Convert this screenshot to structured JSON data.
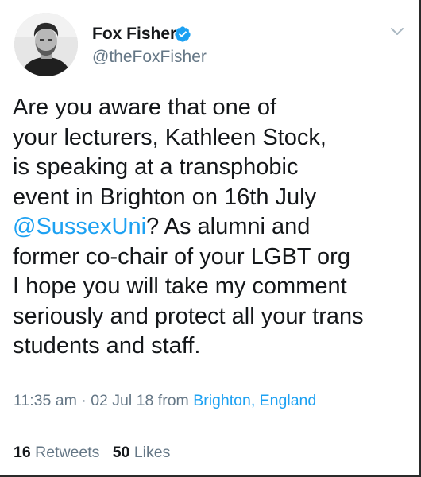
{
  "author": {
    "display_name": "Fox Fisher",
    "handle": "@theFoxFisher",
    "verified": true
  },
  "tweet": {
    "lines": [
      {
        "text": "Are you aware that one of"
      },
      {
        "text": "your lecturers, Kathleen Stock,"
      },
      {
        "text": "is speaking at a transphobic"
      },
      {
        "text": "event in Brighton on 16th July"
      },
      {
        "mention": "@SussexUni",
        "text": "? As alumni and"
      },
      {
        "text": "former co-chair of your LGBT org"
      },
      {
        "text": "I hope you will take my comment"
      },
      {
        "text": "seriously and protect all your trans"
      },
      {
        "text": "students and staff."
      }
    ]
  },
  "meta": {
    "time": "11:35 am",
    "separator": "·",
    "date": "02 Jul 18",
    "from_label": "from",
    "location": "Brighton, England"
  },
  "stats": {
    "retweets_count": "16",
    "retweets_label": "Retweets",
    "likes_count": "50",
    "likes_label": "Likes"
  },
  "colors": {
    "link": "#1da1f2",
    "text": "#14171a",
    "muted": "#657786",
    "verified": "#1da1f2"
  },
  "icons": {
    "verified": "verified-badge-icon",
    "menu": "chevron-down-icon"
  }
}
